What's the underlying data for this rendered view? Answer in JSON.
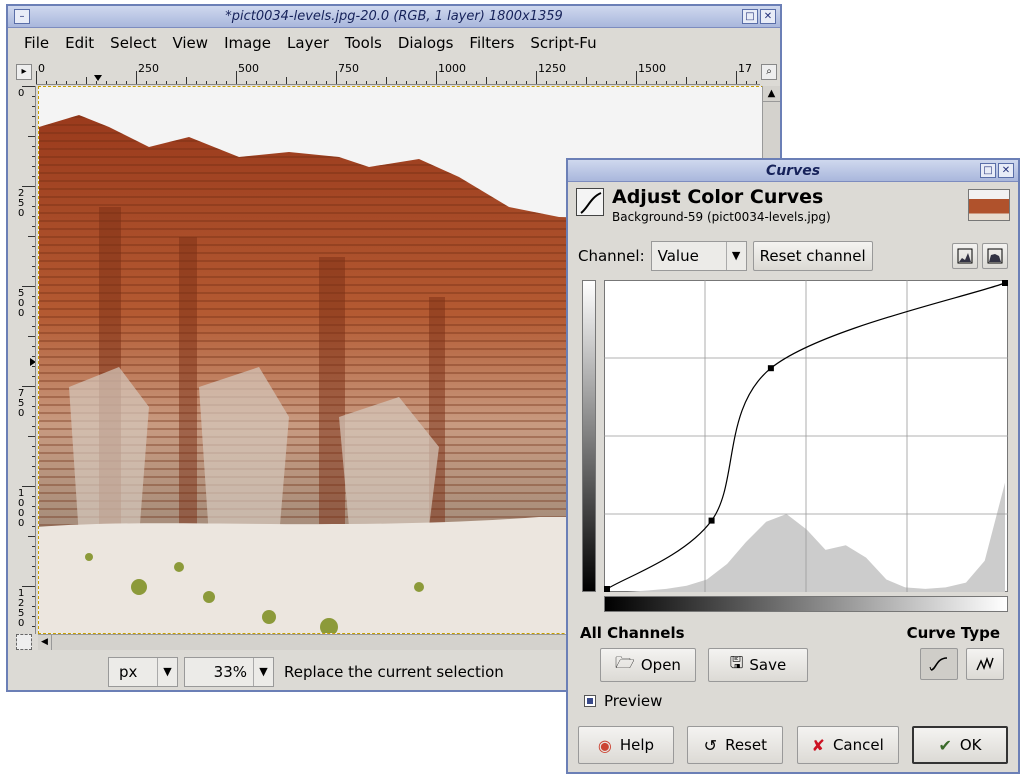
{
  "main_window": {
    "title": "*pict0034-levels.jpg-20.0 (RGB, 1 layer) 1800x1359",
    "menu": [
      "File",
      "Edit",
      "Select",
      "View",
      "Image",
      "Layer",
      "Tools",
      "Dialogs",
      "Filters",
      "Script-Fu"
    ],
    "ruler_h_labels": [
      "0",
      "250",
      "500",
      "750",
      "1000",
      "1250",
      "1500",
      "17"
    ],
    "ruler_v_labels": [
      "0",
      "250",
      "500",
      "750",
      "1000",
      "1250"
    ],
    "status": {
      "unit": "px",
      "zoom": "33%",
      "message": "Replace the current selection"
    }
  },
  "curves_dialog": {
    "title": "Curves",
    "heading": "Adjust Color Curves",
    "subheading": "Background-59 (pict0034-levels.jpg)",
    "channel_label": "Channel:",
    "channel_value": "Value",
    "reset_channel_label": "Reset channel",
    "all_channels_label": "All Channels",
    "curve_type_label": "Curve Type",
    "open_label": "Open",
    "save_label": "Save",
    "preview_label": "Preview",
    "preview_checked": true,
    "help_label": "Help",
    "reset_label": "Reset",
    "cancel_label": "Cancel",
    "ok_label": "OK"
  },
  "chart_data": {
    "type": "line",
    "title": "",
    "xlabel": "",
    "ylabel": "",
    "xlim": [
      0,
      255
    ],
    "ylim": [
      0,
      255
    ],
    "grid": true,
    "series": [
      {
        "points": [
          [
            0,
            0
          ],
          [
            67,
            57
          ],
          [
            105,
            184
          ],
          [
            255,
            255
          ]
        ]
      }
    ],
    "histogram": {
      "x": [
        0,
        13,
        26,
        38,
        51,
        64,
        77,
        89,
        102,
        115,
        128,
        140,
        153,
        166,
        179,
        191,
        204,
        217,
        230,
        242,
        255
      ],
      "values": [
        0,
        0,
        1,
        2,
        4,
        8,
        18,
        32,
        45,
        50,
        40,
        27,
        30,
        22,
        8,
        3,
        2,
        3,
        6,
        20,
        70
      ]
    },
    "colors": {
      "curve": "#000000",
      "histogram": "#cccccc",
      "grid": "#999999"
    }
  }
}
